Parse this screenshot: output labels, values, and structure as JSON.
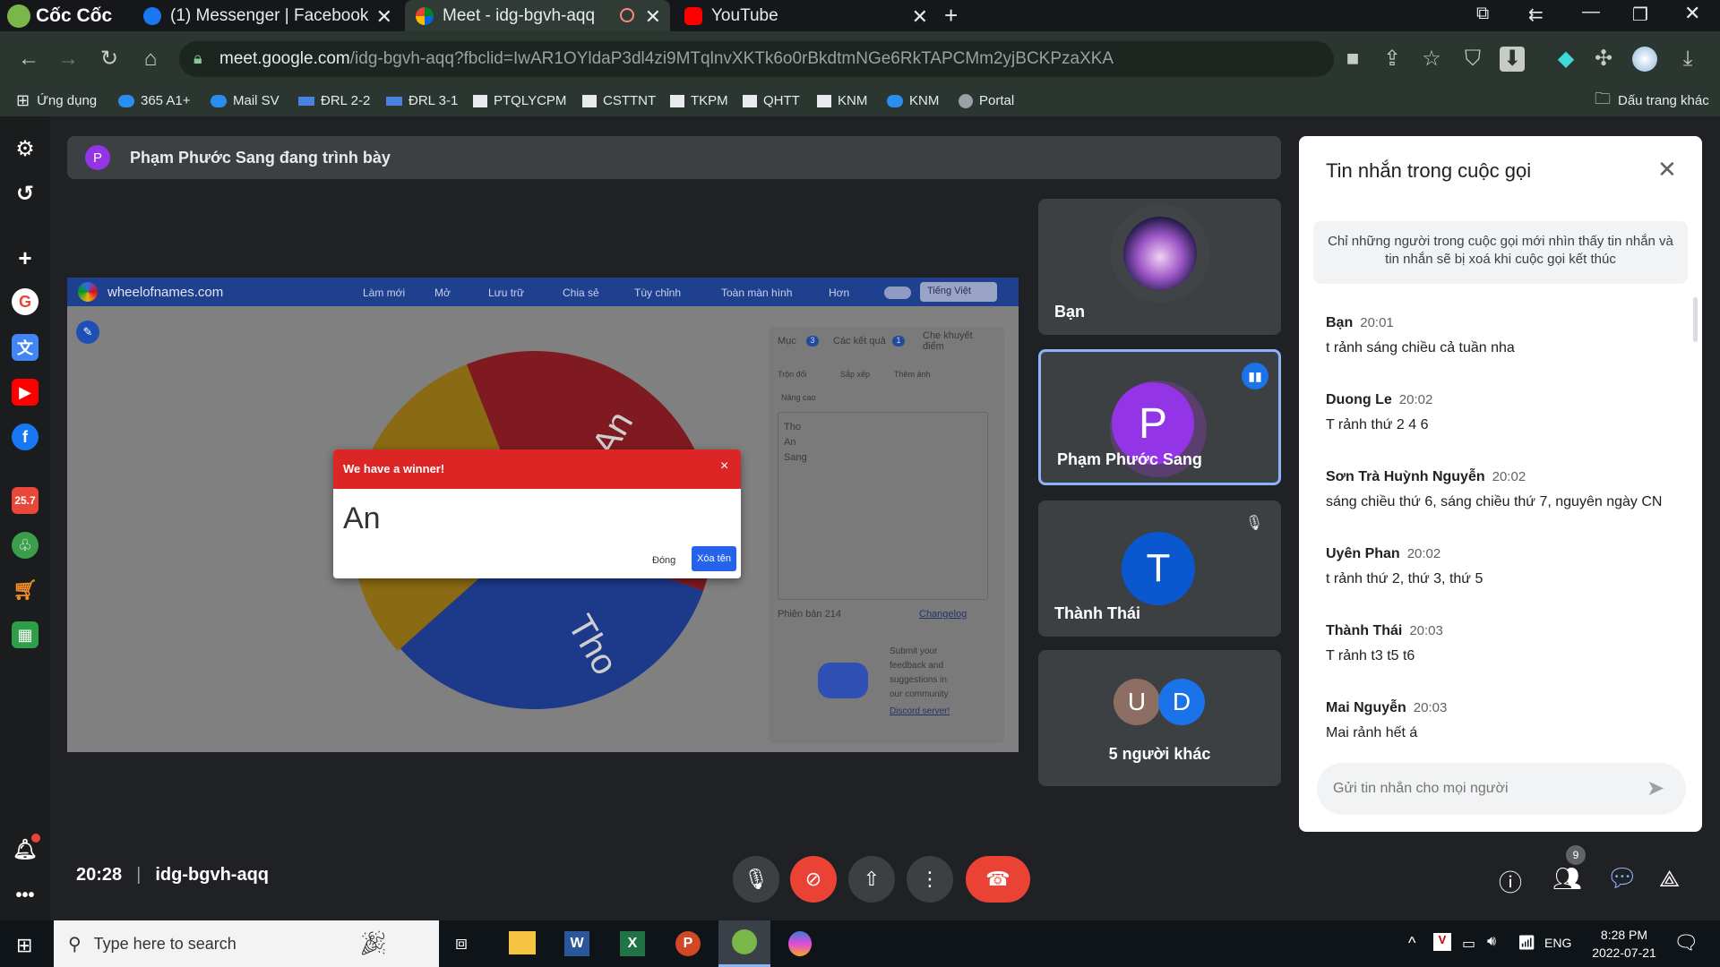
{
  "tabs": [
    {
      "label": "Cốc Cốc",
      "icon": "coccoc-logo-icon"
    },
    {
      "label": "(1) Messenger | Facebook",
      "icon": "facebook-icon"
    },
    {
      "label": "Meet - idg-bgvh-aqq",
      "icon": "meet-icon"
    },
    {
      "label": "YouTube",
      "icon": "youtube-icon"
    }
  ],
  "address": {
    "host": "meet.google.com",
    "path": "/idg-bgvh-aqq?fbclid=IwAR1OYldaP3dl4zi9MTqlnvXKTk6o0rBkdtmNGe6RkTAPCMm2yjBCKPzaXKA"
  },
  "bookmarks": [
    "Ứng dụng",
    "365 A1+",
    "Mail SV",
    "ĐRL 2-2",
    "ĐRL 3-1",
    "PTQLYCPM",
    "CSTTNT",
    "TKPM",
    "QHTT",
    "KNM",
    "KNM",
    "Portal"
  ],
  "other_bookmarks": "Dấu trang khác",
  "presenter": {
    "initial": "P",
    "text": "Phạm Phước Sang đang trình bày"
  },
  "share": {
    "site": "wheelofnames.com",
    "menu": [
      "Làm mới",
      "Mở",
      "Lưu trữ",
      "Chia sẻ",
      "Tùy chỉnh",
      "Toàn màn hình",
      "Hơn"
    ],
    "language": "Tiếng Việt",
    "tabs": [
      "Mục",
      "Các kết quả",
      "Che khuyết điểm"
    ],
    "tab_counts": [
      "3",
      "1"
    ],
    "buttons": [
      "Trộn đổi",
      "Sắp xếp",
      "Thêm ảnh"
    ],
    "advanced": "Nâng cao",
    "entries": [
      "Tho",
      "An",
      "Sang"
    ],
    "version": "Phiên bản 214",
    "changelog": "Changelog",
    "community_text": "Submit your feedback and suggestions in our community",
    "discord_link": "Discord server!",
    "wheel_labels": [
      "An",
      "Tho"
    ],
    "dialog": {
      "title": "We have a winner!",
      "winner": "An",
      "close": "Đóng",
      "remove": "Xóa tên"
    }
  },
  "participants": [
    {
      "name": "Bạn"
    },
    {
      "name": "Phạm Phước Sang",
      "initial": "P",
      "color": "#9334e6"
    },
    {
      "name": "Thành Thái",
      "initial": "T",
      "color": "#0b57d0"
    },
    {
      "name": "5 người khác",
      "initials": [
        "U",
        "D"
      ]
    }
  ],
  "chat": {
    "title": "Tin nhắn trong cuộc gọi",
    "notice": "Chỉ những người trong cuộc gọi mới nhìn thấy tin nhắn và tin nhắn sẽ bị xoá khi cuộc gọi kết thúc",
    "messages": [
      {
        "who": "Bạn",
        "time": "20:01",
        "text": "t rảnh sáng chiều cả tuần nha"
      },
      {
        "who": "Duong Le",
        "time": "20:02",
        "text": "T rảnh thứ 2 4 6"
      },
      {
        "who": "Sơn Trà Huỳnh Nguyễn",
        "time": "20:02",
        "text": "sáng chiều thứ 6, sáng chiều thứ 7, nguyên ngày CN"
      },
      {
        "who": "Uyên Phan",
        "time": "20:02",
        "text": "t rảnh thứ 2, thứ 3, thứ 5"
      },
      {
        "who": "Thành Thái",
        "time": "20:03",
        "text": "T rảnh t3 t5 t6"
      },
      {
        "who": "Mai Nguyễn",
        "time": "20:03",
        "text": "Mai rảnh hết á"
      }
    ],
    "placeholder": "Gửi tin nhắn cho mọi người"
  },
  "meeting": {
    "time": "20:28",
    "code": "idg-bgvh-aqq",
    "people_count": "9"
  },
  "taskbar": {
    "search": "Type here to search",
    "lang": "ENG",
    "clock": "8:28 PM",
    "date": "2022-07-21"
  },
  "colors": {
    "accent": "#8ab4f8",
    "end_call": "#ea4335",
    "wheel_red": "#b5202b",
    "wheel_blue": "#2a52be",
    "wheel_gold": "#d59d0f"
  }
}
